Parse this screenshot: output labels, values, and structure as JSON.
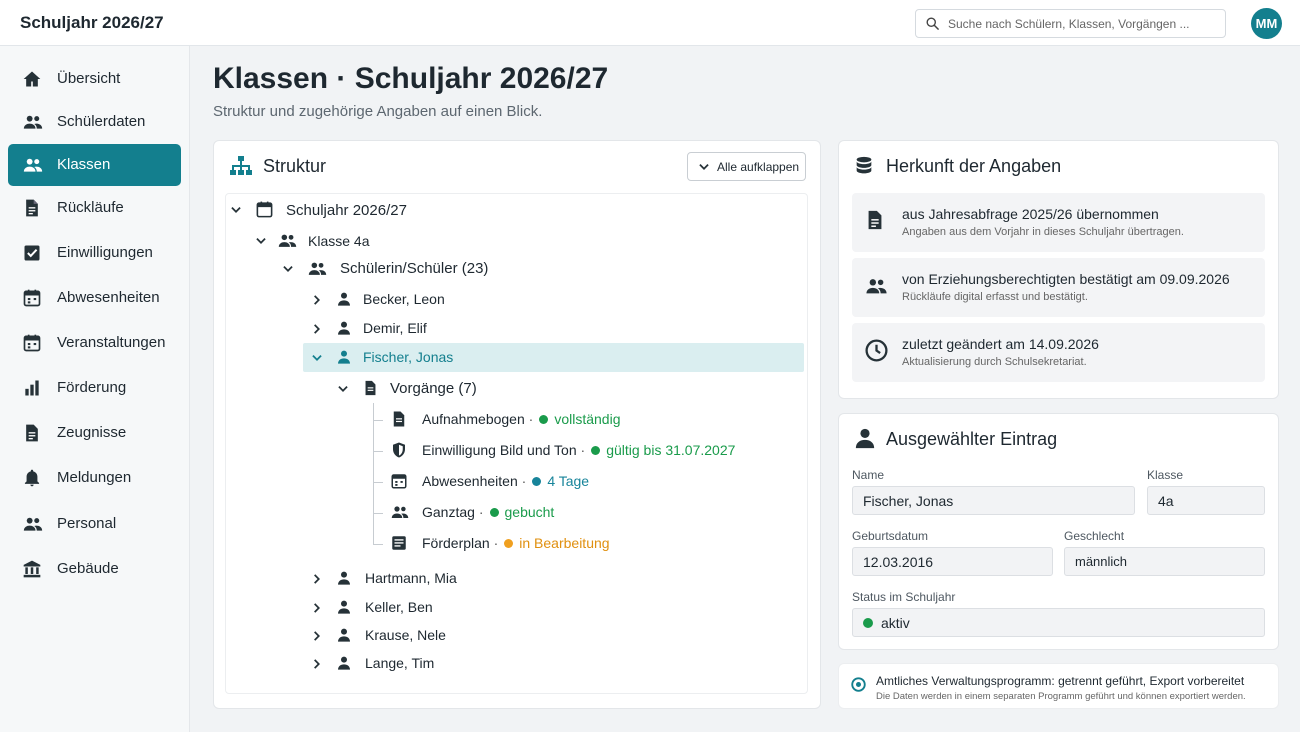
{
  "app": {
    "title": "Schuljahr 2026/27",
    "search_placeholder": "Suche nach Schülern, Klassen, Vorgängen ...",
    "user_initials": "MM"
  },
  "sidebar": {
    "items": [
      {
        "label": "Übersicht",
        "icon": "home-icon"
      },
      {
        "label": "Schülerdaten",
        "icon": "people-icon"
      },
      {
        "label": "Klassen",
        "icon": "people-icon",
        "active": true
      },
      {
        "label": "Rückläufe",
        "icon": "document-icon"
      },
      {
        "label": "Einwilligungen",
        "icon": "checkbox-icon"
      },
      {
        "label": "Abwesenheiten",
        "icon": "calendar-icon"
      },
      {
        "label": "Veranstaltungen",
        "icon": "calendar-icon"
      },
      {
        "label": "Förderung",
        "icon": "bar-chart-icon"
      },
      {
        "label": "Zeugnisse",
        "icon": "document-icon"
      },
      {
        "label": "Meldungen",
        "icon": "bell-icon"
      },
      {
        "label": "Personal",
        "icon": "people-icon"
      },
      {
        "label": "Gebäude",
        "icon": "building-icon"
      }
    ]
  },
  "main": {
    "title": "Klassen · Schuljahr 2026/27",
    "subtitle": "Struktur und zugehörige Angaben auf einen Blick."
  },
  "structure": {
    "title": "Struktur",
    "expand_all_label": "Alle aufklappen",
    "root": "Schuljahr 2026/27",
    "class": "Klasse 4a",
    "students_group": "Schülerin/Schüler (23)",
    "students_before": [
      "Becker, Leon",
      "Demir, Elif"
    ],
    "selected_student": "Fischer, Jonas",
    "processes_label": "Vorgänge (7)",
    "processes": [
      {
        "name": "Aufnahmebogen",
        "status": "vollständig",
        "color": "#1a9b4b",
        "text_color": "#1a9b4b"
      },
      {
        "name": "Einwilligung Bild und Ton",
        "status": "gültig bis 31.07.2027",
        "color": "#1a9b4b",
        "text_color": "#1a9b4b"
      },
      {
        "name": "Abwesenheiten",
        "status": "4 Tage",
        "color": "#17849a",
        "text_color": "#17849a"
      },
      {
        "name": "Ganztag",
        "status": "gebucht",
        "color": "#1a9b4b",
        "text_color": "#1a9b4b"
      },
      {
        "name": "Förderplan",
        "status": "in Bearbeitung",
        "color": "#f0a020",
        "text_color": "#e09010"
      }
    ],
    "students_after": [
      "Hartmann, Mia",
      "Keller, Ben",
      "Krause, Nele",
      "Lange, Tim"
    ]
  },
  "origin": {
    "title": "Herkunft der Angaben",
    "items": [
      {
        "title": "aus Jahresabfrage 2025/26 übernommen",
        "desc": "Angaben aus dem Vorjahr in dieses Schuljahr übertragen.",
        "icon": "database-document-icon"
      },
      {
        "title": "von Erziehungsberechtigten bestätigt am 09.09.2026",
        "desc": "Rückläufe digital erfasst und bestätigt.",
        "icon": "people-icon"
      },
      {
        "title": "zuletzt geändert am 14.09.2026",
        "desc": "Aktualisierung durch Schulsekretariat.",
        "icon": "clock-icon"
      }
    ]
  },
  "selected": {
    "title": "Ausgewählter Eintrag",
    "name_label": "Name",
    "name": "Fischer, Jonas",
    "class_label": "Klasse",
    "class": "4a",
    "birth_label": "Geburtsdatum",
    "birth": "12.03.2016",
    "gender_label": "Geschlecht",
    "gender": "männlich",
    "status_label": "Status im Schuljahr",
    "status": "aktiv",
    "status_color": "#1a9b4b"
  },
  "notice": {
    "title": "Amtliches Verwaltungsprogramm: getrennt geführt, Export vorbereitet",
    "desc": "Die Daten werden in einem separaten Programm geführt und können exportiert werden."
  },
  "colors": {
    "accent": "#137f8e",
    "green": "#1a9b4b",
    "orange": "#f0a020",
    "teal": "#17849a"
  }
}
